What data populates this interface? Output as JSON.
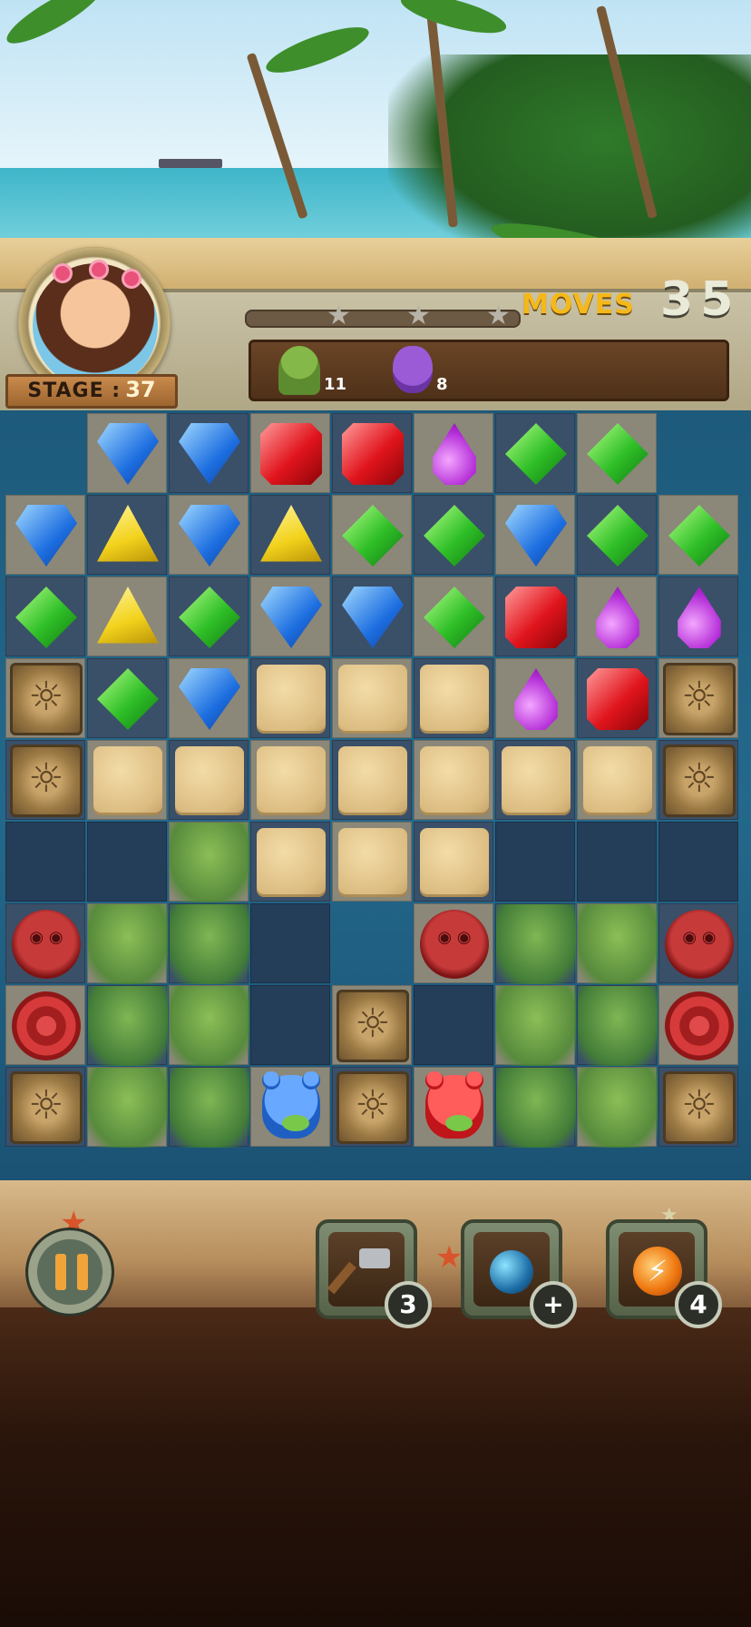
{
  "header": {
    "stage_label": "STAGE :",
    "stage_number": "37",
    "moves_label": "MOVES",
    "moves_value": "35",
    "stars_earned": 0,
    "stars_total": 3
  },
  "goals": [
    {
      "icon": "green-owl-icon",
      "count": "11"
    },
    {
      "icon": "purple-bear-icon",
      "count": "8"
    }
  ],
  "board": {
    "rows": [
      [
        "empty",
        "blue",
        "blue",
        "red",
        "red",
        "purple",
        "green",
        "green",
        "empty"
      ],
      [
        "blue",
        "yellow",
        "blue",
        "yellow",
        "green",
        "green",
        "blue",
        "green",
        "green"
      ],
      [
        "green",
        "yellow",
        "green",
        "blue",
        "blue",
        "green",
        "red",
        "purple",
        "purple"
      ],
      [
        "crate",
        "green",
        "blue",
        "sand",
        "sand",
        "sand",
        "purple",
        "red",
        "crate"
      ],
      [
        "crate",
        "sand",
        "sand",
        "sand",
        "sand",
        "sand",
        "sand",
        "sand",
        "crate"
      ],
      [
        "dark",
        "dark",
        "shell",
        "sand",
        "sand",
        "sand",
        "dark",
        "dark",
        "dark"
      ],
      [
        "owl-red",
        "shell",
        "shell",
        "dark",
        "water",
        "owl-red",
        "shell",
        "shell",
        "owl-red"
      ],
      [
        "scales-red",
        "shell",
        "shell",
        "dark",
        "crate",
        "dark",
        "shell",
        "shell",
        "scales-red"
      ],
      [
        "crate",
        "shell",
        "shell",
        "bear-blue",
        "crate",
        "bear-red",
        "shell",
        "shell",
        "crate"
      ]
    ]
  },
  "boosters": [
    {
      "name": "hammer",
      "count": "3"
    },
    {
      "name": "bomb",
      "count": "+"
    },
    {
      "name": "lightning",
      "count": "4"
    }
  ],
  "colors": {
    "moves_label": "#f4b81a",
    "pause_icon": "#f0a43a"
  }
}
